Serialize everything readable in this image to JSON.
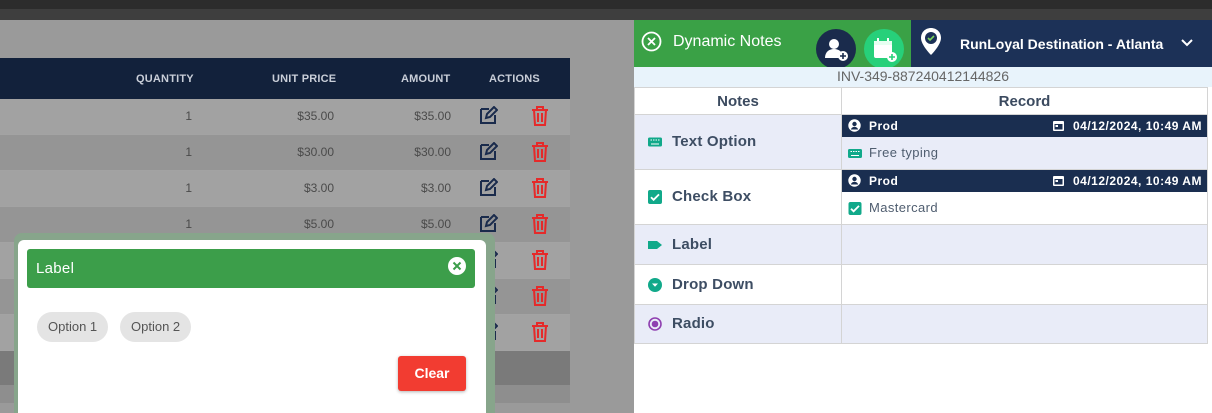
{
  "invoice_table": {
    "headers": {
      "quantity": "QUANTITY",
      "unit_price": "UNIT PRICE",
      "amount": "AMOUNT",
      "actions": "ACTIONS"
    },
    "rows": [
      {
        "quantity": "1",
        "unit_price": "$35.00",
        "amount": "$35.00"
      },
      {
        "quantity": "1",
        "unit_price": "$30.00",
        "amount": "$30.00"
      },
      {
        "quantity": "1",
        "unit_price": "$3.00",
        "amount": "$3.00"
      },
      {
        "quantity": "1",
        "unit_price": "$5.00",
        "amount": "$5.00"
      }
    ]
  },
  "label_popup": {
    "title": "Label",
    "options": [
      "Option 1",
      "Option 2"
    ],
    "clear_label": "Clear"
  },
  "dynamic_notes": {
    "title": "Dynamic Notes",
    "location": "RunLoyal Destination - Atlanta",
    "invoice_id": "INV-349-887240412144826",
    "columns": {
      "notes": "Notes",
      "record": "Record"
    },
    "rows": [
      {
        "name": "Text Option",
        "icon": "keyboard-icon",
        "record_user": "Prod",
        "record_time": "04/12/2024, 10:49 AM",
        "record_value": "Free typing"
      },
      {
        "name": "Check Box",
        "icon": "checkbox-icon",
        "record_user": "Prod",
        "record_time": "04/12/2024, 10:49 AM",
        "record_value": "Mastercard"
      },
      {
        "name": "Label",
        "icon": "tag-icon"
      },
      {
        "name": "Drop Down",
        "icon": "dropdown-circle-icon"
      },
      {
        "name": "Radio",
        "icon": "radio-icon"
      }
    ]
  },
  "colors": {
    "navy": "#12213b",
    "green": "#3aa146",
    "accent_green": "#27d07a",
    "danger": "#f23c31",
    "delete_red": "#e52a2a",
    "teal_icon": "#11a98a",
    "radio_purple": "#8f3fb0"
  }
}
